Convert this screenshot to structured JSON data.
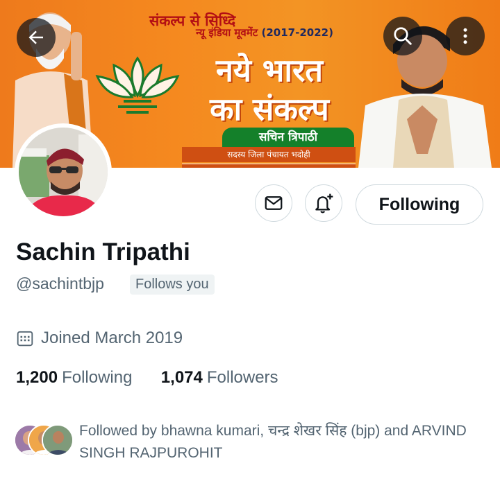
{
  "banner": {
    "line1": "संकल्प से सिध्दि",
    "line2": "न्यू इंडिया मूवमेंट",
    "years": "(2017-2022)",
    "title_line1": "नये भारत",
    "title_line2": "का संकल्प",
    "name": "सचिन त्रिपाठी",
    "designation": "सदस्य जिला पंचायत भदोही",
    "colors": {
      "orange": "#f5891f",
      "green": "#14802a",
      "red": "#b30f14"
    }
  },
  "nav": {
    "back_icon": "arrow-left-icon",
    "search_icon": "search-icon",
    "more_icon": "more-vertical-icon"
  },
  "actions": {
    "message_icon": "envelope-icon",
    "notify_icon": "bell-plus-icon",
    "following_label": "Following"
  },
  "profile": {
    "display_name": "Sachin Tripathi",
    "handle": "@sachintbjp",
    "follows_you": "Follows you",
    "joined": "Joined March 2019",
    "calendar_icon": "calendar-icon"
  },
  "stats": {
    "following_count": "1,200",
    "following_label": "Following",
    "followers_count": "1,074",
    "followers_label": "Followers"
  },
  "followed_by": {
    "text": "Followed by bhawna kumari, चन्द्र शेखर सिंह (bjp) and ARVIND SINGH RAJPUROHIT"
  },
  "theme": {
    "text_primary": "#0f1419",
    "text_secondary": "#536471",
    "border": "#cfd9de"
  }
}
